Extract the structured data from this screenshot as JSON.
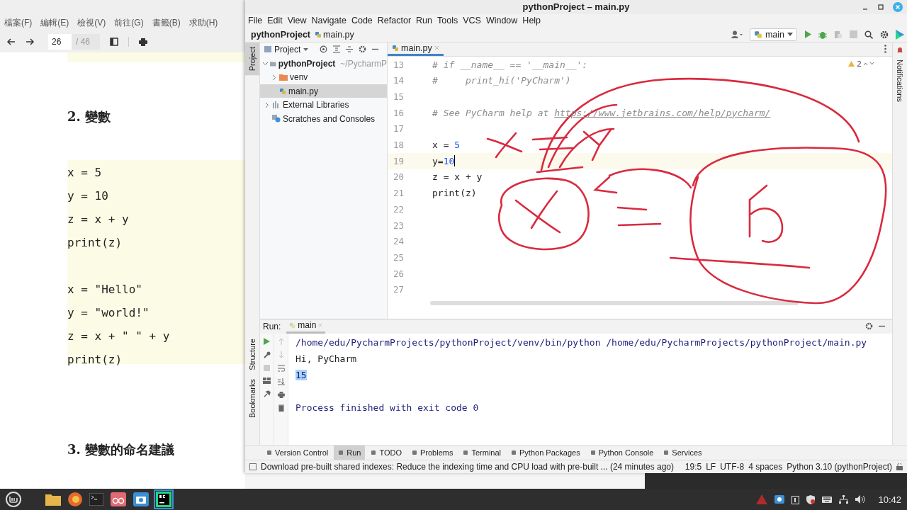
{
  "viewer": {
    "menu": [
      "檔案(F)",
      "編輯(E)",
      "檢視(V)",
      "前往(G)",
      "書籤(B)",
      "求助(H)"
    ],
    "page_number": "26",
    "page_total": "/ 46",
    "heading_2": "2. 變數",
    "code_blocks": [
      [
        "x = 5",
        "y = 10",
        "z = x + y",
        "print(z)"
      ],
      [
        "x = \"Hello\"",
        "y = \"world!\"",
        "z = x + \" \" + y",
        "print(z)"
      ]
    ],
    "heading_3": "3. 變數的命名建議"
  },
  "ide": {
    "title": "pythonProject – main.py",
    "menu": [
      "File",
      "Edit",
      "View",
      "Navigate",
      "Code",
      "Refactor",
      "Run",
      "Tools",
      "VCS",
      "Window",
      "Help"
    ],
    "breadcrumb": [
      "pythonProject",
      "main.py"
    ],
    "run_config": "main",
    "left_stripe": [
      "Project",
      "Structure",
      "Bookmarks"
    ],
    "right_stripe": "Notifications",
    "project_panel": {
      "title": "Project",
      "tree": [
        {
          "label": "pythonProject",
          "hint": "~/PycharmP",
          "kind": "folder",
          "expanded": true,
          "selected": false,
          "children": [
            {
              "label": "venv",
              "kind": "folder",
              "expanded": false,
              "selected": false
            },
            {
              "label": "main.py",
              "kind": "file",
              "selected": true
            }
          ]
        },
        {
          "label": "External Libraries",
          "kind": "library",
          "expanded": false,
          "selected": false
        },
        {
          "label": "Scratches and Consoles",
          "kind": "scratch",
          "selected": false
        }
      ]
    },
    "editor": {
      "tab": "main.py",
      "warnings": "2",
      "lines": [
        {
          "number": "13",
          "current": false,
          "tokens": [
            {
              "text": "# if __name__ == '__main__':",
              "kind": "comment"
            }
          ]
        },
        {
          "number": "14",
          "current": false,
          "tokens": [
            {
              "text": "#     print_hi('PyCharm')",
              "kind": "comment"
            }
          ]
        },
        {
          "number": "15",
          "current": false
        },
        {
          "number": "16",
          "current": false,
          "tokens": [
            {
              "text": "# See PyCharm help at ",
              "kind": "comment"
            },
            {
              "text": "https://www.jetbrains.com/help/pycharm/",
              "kind": "link"
            }
          ]
        },
        {
          "number": "17",
          "current": false
        },
        {
          "number": "18",
          "current": false,
          "tokens": [
            {
              "text": "x = ",
              "kind": "plain"
            },
            {
              "text": "5",
              "kind": "number"
            }
          ]
        },
        {
          "number": "19",
          "current": true,
          "tokens": [
            {
              "text": "y=",
              "kind": "plain"
            },
            {
              "text": "10",
              "kind": "number"
            }
          ]
        },
        {
          "number": "20",
          "current": false,
          "tokens": [
            {
              "text": "z = x + y",
              "kind": "plain"
            }
          ]
        },
        {
          "number": "21",
          "current": false,
          "tokens": [
            {
              "text": "print(z)",
              "kind": "plain"
            }
          ]
        },
        {
          "number": "22",
          "current": false
        },
        {
          "number": "23",
          "current": false
        },
        {
          "number": "24",
          "current": false
        },
        {
          "number": "25",
          "current": false
        },
        {
          "number": "26",
          "current": false
        },
        {
          "number": "27",
          "current": false
        }
      ]
    },
    "run": {
      "label": "Run:",
      "tab": "main",
      "output": [
        {
          "text": "/home/edu/PycharmProjects/pythonProject/venv/bin/python /home/edu/PycharmProjects/pythonProject/main.py",
          "kind": "command"
        },
        {
          "text": "Hi, PyCharm",
          "kind": "stdout"
        },
        {
          "text": "15",
          "kind": "selected"
        },
        {
          "text": "Process finished with exit code 0",
          "kind": "exit"
        }
      ]
    },
    "tool_tabs": [
      {
        "label": "Version Control",
        "selected": false
      },
      {
        "label": "Run",
        "selected": true
      },
      {
        "label": "TODO",
        "selected": false
      },
      {
        "label": "Problems",
        "selected": false
      },
      {
        "label": "Terminal",
        "selected": false
      },
      {
        "label": "Python Packages",
        "selected": false
      },
      {
        "label": "Python Console",
        "selected": false
      },
      {
        "label": "Services",
        "selected": false
      }
    ],
    "status": {
      "message": "Download pre-built shared indexes: Reduce the indexing time and CPU load with pre-built ... (24 minutes ago)",
      "items": [
        "19:5",
        "LF",
        "UTF-8",
        "4 spaces",
        "Python 3.10 (pythonProject)"
      ]
    }
  },
  "taskbar": {
    "clock": "10:42"
  }
}
